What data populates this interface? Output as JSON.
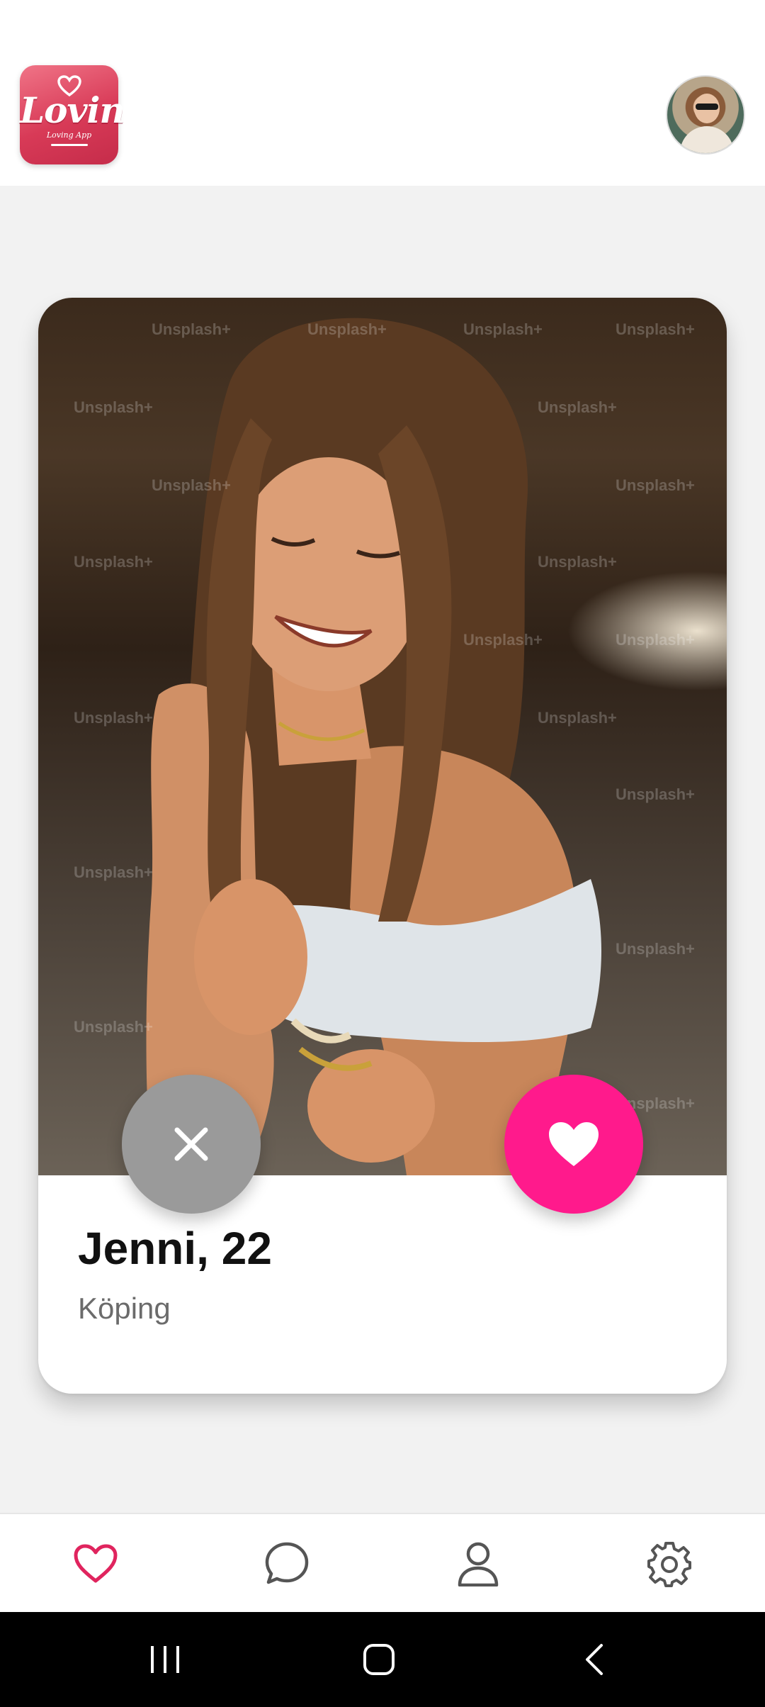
{
  "app": {
    "logo_text": "Lovin",
    "logo_tagline": "Loving App"
  },
  "header": {
    "avatar_icon": "user-avatar-photo"
  },
  "profile_card": {
    "name_age": "Jenni, 22",
    "location": "Köping",
    "watermark_text": "Unsplash+",
    "pass_button_icon": "close-icon",
    "like_button_icon": "heart-filled-icon"
  },
  "bottom_nav": {
    "items": [
      {
        "icon": "heart-outline-icon",
        "active": true
      },
      {
        "icon": "chat-bubble-icon",
        "active": false
      },
      {
        "icon": "person-icon",
        "active": false
      },
      {
        "icon": "gear-icon",
        "active": false
      }
    ]
  },
  "system_nav": {
    "items": [
      "recent-apps-icon",
      "home-icon",
      "back-icon"
    ]
  },
  "colors": {
    "accent_pink": "#ff1a8c",
    "logo_red": "#d83a57",
    "pass_gray": "#9a9a9a",
    "nav_active": "#e0245e",
    "nav_inactive": "#555555"
  }
}
